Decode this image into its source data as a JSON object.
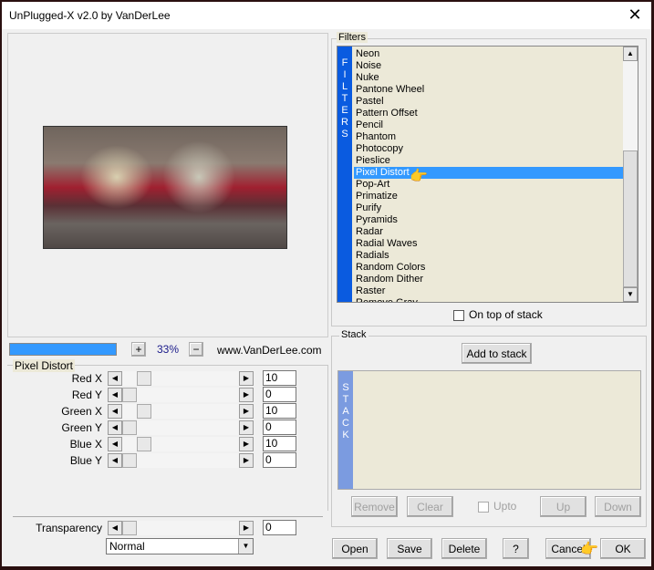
{
  "window": {
    "title": "UnPlugged-X v2.0 by VanDerLee",
    "close_icon": "close-icon"
  },
  "preview": {
    "zoom": "33%",
    "plus": "+",
    "minus": "−",
    "website": "www.VanDerLee.com",
    "progress_percent": 100
  },
  "params": {
    "group_label": "Pixel Distort",
    "sliders": [
      {
        "label": "Red X",
        "value": "10"
      },
      {
        "label": "Red Y",
        "value": "0"
      },
      {
        "label": "Green X",
        "value": "10"
      },
      {
        "label": "Green Y",
        "value": "0"
      },
      {
        "label": "Blue X",
        "value": "10"
      },
      {
        "label": "Blue Y",
        "value": "0"
      }
    ],
    "transparency": {
      "label": "Transparency",
      "value": "0"
    },
    "blend_mode": "Normal"
  },
  "filters": {
    "group_label": "Filters",
    "strip_text": "FILTERS",
    "selected": "Pixel Distort",
    "items": [
      "Neon",
      "Noise",
      "Nuke",
      "Pantone Wheel",
      "Pastel",
      "Pattern Offset",
      "Pencil",
      "Phantom",
      "Photocopy",
      "Pieslice",
      "Pixel Distort",
      "Pop-Art",
      "Primatize",
      "Purify",
      "Pyramids",
      "Radar",
      "Radial Waves",
      "Radials",
      "Random Colors",
      "Random Dither",
      "Raster",
      "Remove Gray"
    ],
    "on_top_label": "On top of stack",
    "on_top_checked": false
  },
  "stack": {
    "group_label": "Stack",
    "strip_text": "STACK",
    "add": "Add to stack",
    "remove": "Remove",
    "clear": "Clear",
    "upto": "Upto",
    "up": "Up",
    "down": "Down"
  },
  "buttons": {
    "open": "Open",
    "save": "Save",
    "delete": "Delete",
    "help": "?",
    "cancel": "Cancel",
    "ok": "OK"
  },
  "colors": {
    "accent": "#3399ff",
    "strip": "#0a5be0",
    "stack_strip": "#7b9be0"
  }
}
